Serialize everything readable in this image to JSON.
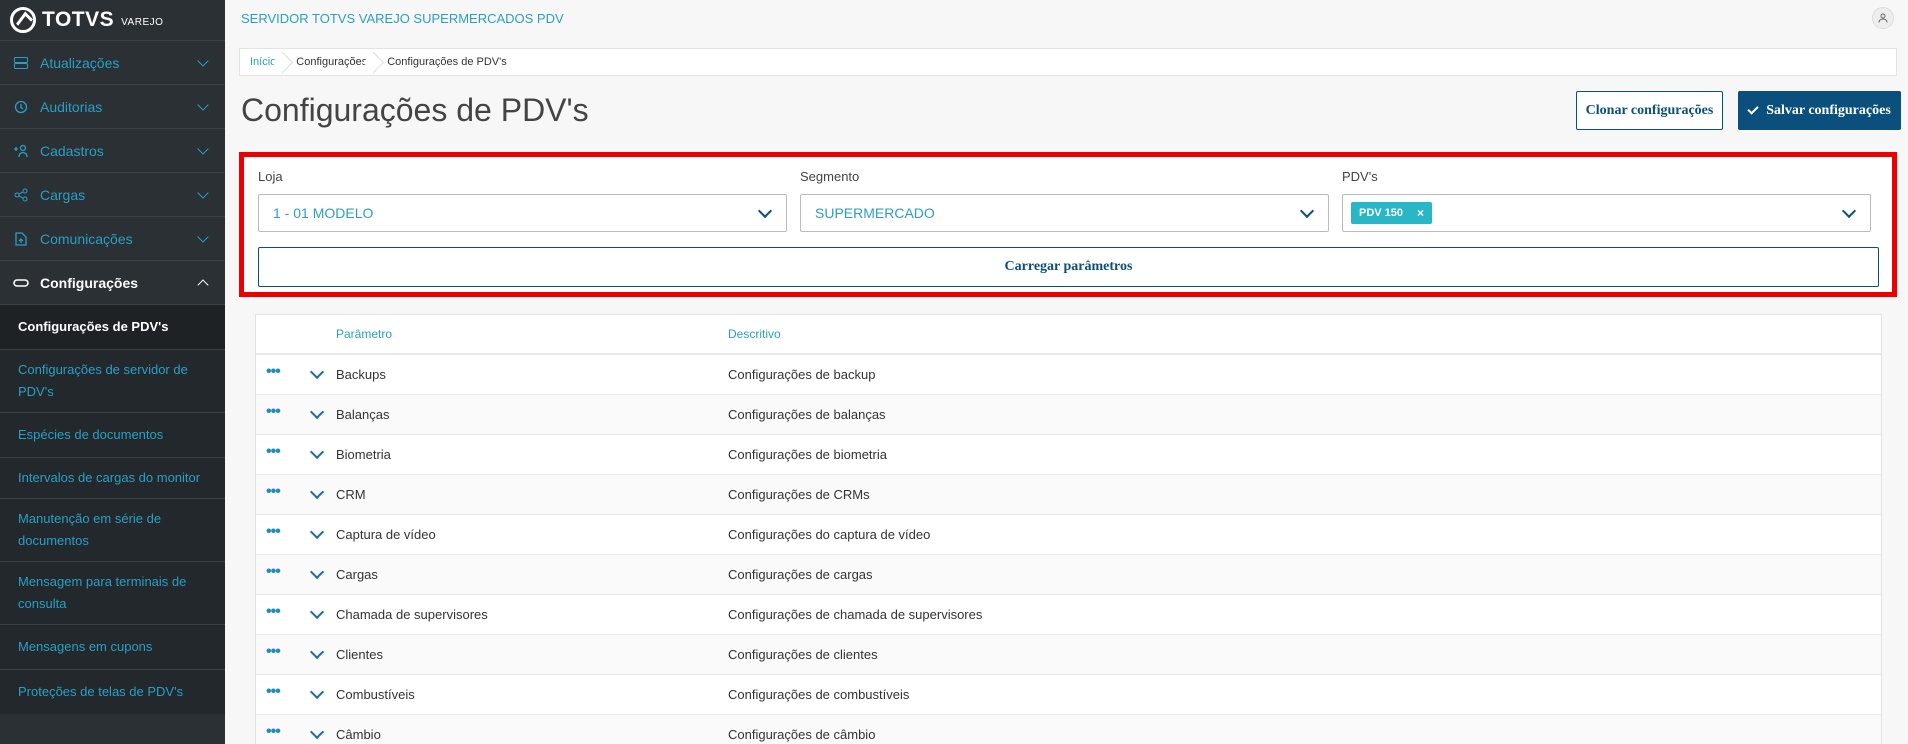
{
  "brand": {
    "name": "TOTVS",
    "sub": "VAREJO"
  },
  "sidebar": {
    "items": [
      {
        "label": "Atualizações",
        "icon": "server-icon"
      },
      {
        "label": "Auditorias",
        "icon": "history-icon"
      },
      {
        "label": "Cadastros",
        "icon": "add-user-icon"
      },
      {
        "label": "Cargas",
        "icon": "share-icon"
      },
      {
        "label": "Comunicações",
        "icon": "document-upload-icon"
      },
      {
        "label": "Configurações",
        "icon": "link-icon"
      }
    ],
    "subitems": [
      "Configurações de PDV's",
      "Configurações de servidor de PDV's",
      "Espécies de documentos",
      "Intervalos de cargas do monitor",
      "Manutenção em série de documentos",
      "Mensagem para terminais de consulta",
      "Mensagens em cupons",
      "Proteções de telas de PDV's"
    ]
  },
  "header": {
    "title": "SERVIDOR TOTVS VAREJO SUPERMERCADOS PDV"
  },
  "breadcrumb": [
    "Início",
    "Configurações",
    "Configurações de PDV's"
  ],
  "page": {
    "title": "Configurações de PDV's",
    "clone_label": "Clonar configurações",
    "save_label": "Salvar configurações"
  },
  "filters": {
    "loja": {
      "label": "Loja",
      "value": "1 - 01 MODELO"
    },
    "segmento": {
      "label": "Segmento",
      "value": "SUPERMERCADO"
    },
    "pdvs": {
      "label": "PDV's",
      "tag": "PDV 150",
      "remove": "×"
    },
    "load_label": "Carregar parâmetros"
  },
  "table": {
    "columns": [
      "Parâmetro",
      "Descritivo"
    ],
    "rows": [
      [
        "Backups",
        "Configurações de backup"
      ],
      [
        "Balanças",
        "Configurações de balanças"
      ],
      [
        "Biometria",
        "Configurações de biometria"
      ],
      [
        "CRM",
        "Configurações de CRMs"
      ],
      [
        "Captura de vídeo",
        "Configurações do captura de vídeo"
      ],
      [
        "Cargas",
        "Configurações de cargas"
      ],
      [
        "Chamada de supervisores",
        "Configurações de chamada de supervisores"
      ],
      [
        "Clientes",
        "Configurações de clientes"
      ],
      [
        "Combustíveis",
        "Configurações de combustíveis"
      ],
      [
        "Câmbio",
        "Configurações de câmbio"
      ]
    ]
  }
}
